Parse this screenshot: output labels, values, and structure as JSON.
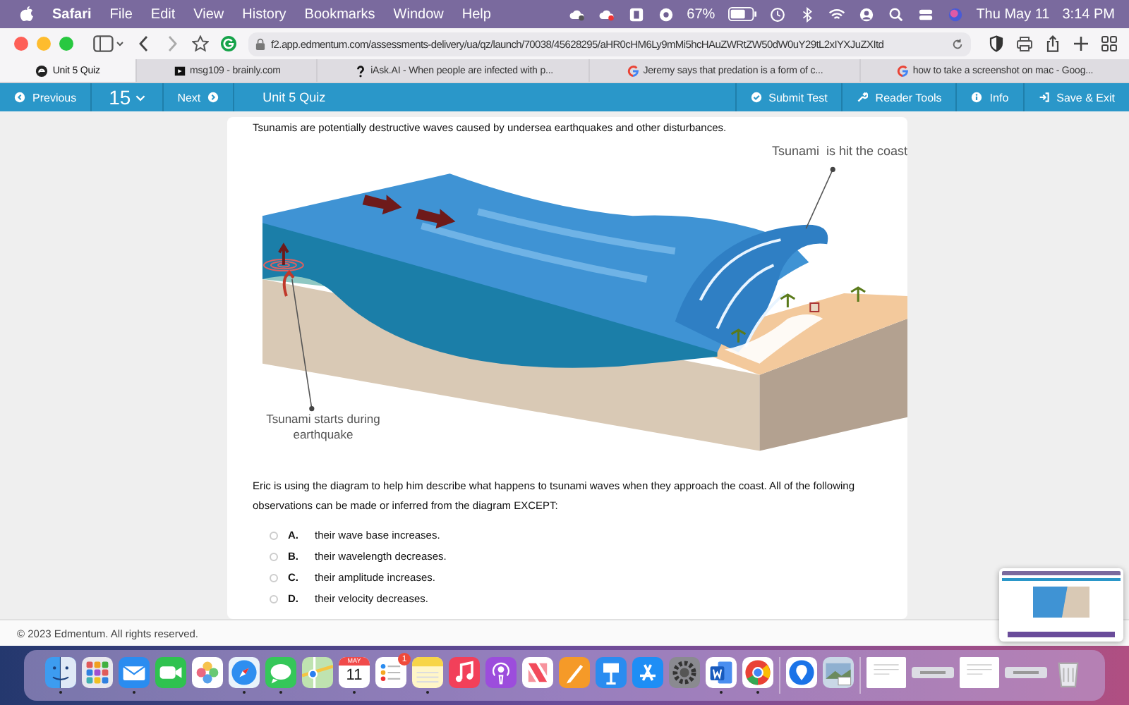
{
  "menu_bar": {
    "app": "Safari",
    "menus": [
      "File",
      "Edit",
      "View",
      "History",
      "Bookmarks",
      "Window",
      "Help"
    ],
    "battery": "67%",
    "date": "Thu May 11",
    "time": "3:14 PM"
  },
  "browser": {
    "url": "f2.app.edmentum.com/assessments-delivery/ua/qz/launch/70038/45628295/aHR0cHM6Ly9mMi5hcHAuZWRtZW50dW0uY29tL2xIYXJuZXItd",
    "tabs": [
      {
        "title": "Unit 5 Quiz",
        "kind": "edmentum",
        "selected": true
      },
      {
        "title": "msg109 - brainly.com",
        "kind": "brainly",
        "selected": false
      },
      {
        "title": "iAsk.AI - When people are infected with p...",
        "kind": "iask",
        "selected": false
      },
      {
        "title": "Jeremy says that predation is a form of c...",
        "kind": "google",
        "selected": false
      },
      {
        "title": "how to take a screenshot on mac - Goog...",
        "kind": "google",
        "selected": false
      }
    ]
  },
  "quiz_nav": {
    "previous": "Previous",
    "question_number": "15",
    "next": "Next",
    "title": "Unit 5 Quiz",
    "actions": [
      {
        "label": "Submit Test",
        "kind": "submit"
      },
      {
        "label": "Reader Tools",
        "kind": "tools"
      },
      {
        "label": "Info",
        "kind": "info"
      },
      {
        "label": "Save & Exit",
        "kind": "exit"
      }
    ]
  },
  "question": {
    "intro": "Tsunamis are potentially destructive waves caused by undersea earthquakes and other disturbances.",
    "diagram": {
      "label_top": "Tsunami  is hit the coast",
      "label_bottom": "Tsunami starts during earthquake"
    },
    "prompt": "Eric is using the diagram to help him describe what happens to tsunami waves when they approach the coast. All of the following observations can be made or inferred from the diagram EXCEPT:",
    "options": [
      {
        "letter": "A.",
        "text": "their wave base increases.",
        "selected": false
      },
      {
        "letter": "B.",
        "text": "their wavelength decreases.",
        "selected": false
      },
      {
        "letter": "C.",
        "text": "their amplitude increases.",
        "selected": false
      },
      {
        "letter": "D.",
        "text": "their velocity decreases.",
        "selected": false
      }
    ]
  },
  "footer": "© 2023 Edmentum. All rights reserved.",
  "dock": [
    {
      "kind": "finder",
      "running": true
    },
    {
      "kind": "launchpad",
      "running": false
    },
    {
      "kind": "mail",
      "running": true
    },
    {
      "kind": "facetime",
      "running": false
    },
    {
      "kind": "photos",
      "running": false
    },
    {
      "kind": "safari",
      "running": true
    },
    {
      "kind": "messages",
      "running": true
    },
    {
      "kind": "maps",
      "running": false
    },
    {
      "kind": "calendar",
      "running": true,
      "month": "MAY",
      "day": "11"
    },
    {
      "kind": "reminders",
      "running": false,
      "badge": "1"
    },
    {
      "kind": "notes",
      "running": true
    },
    {
      "kind": "music",
      "running": false
    },
    {
      "kind": "podcasts",
      "running": false
    },
    {
      "kind": "news",
      "running": false
    },
    {
      "kind": "pages",
      "running": false
    },
    {
      "kind": "keynote",
      "running": false
    },
    {
      "kind": "appstore",
      "running": false
    },
    {
      "kind": "settings",
      "running": false
    },
    {
      "kind": "word",
      "running": true
    },
    {
      "kind": "chrome",
      "running": true
    },
    {
      "kind": "separator"
    },
    {
      "kind": "pin",
      "running": false
    },
    {
      "kind": "preview",
      "running": false
    },
    {
      "kind": "separator"
    },
    {
      "kind": "window",
      "running": false
    },
    {
      "kind": "bar",
      "running": false
    },
    {
      "kind": "window",
      "running": false
    },
    {
      "kind": "bar",
      "running": false
    },
    {
      "kind": "trash",
      "running": false
    }
  ]
}
